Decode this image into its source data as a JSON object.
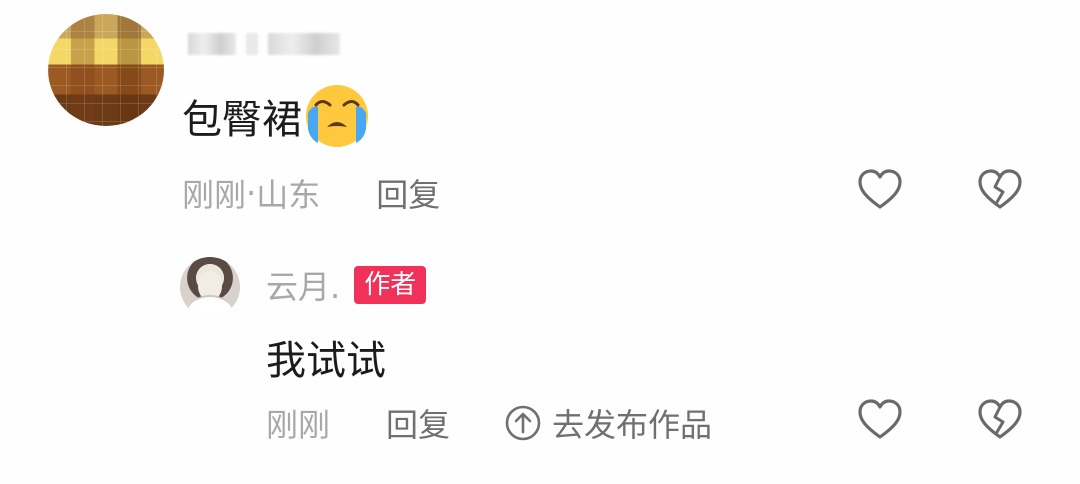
{
  "comment": {
    "text": "包臀裙",
    "emoji": "loudly-crying-face-emoji",
    "time": "刚刚",
    "separator": " · ",
    "location": "山东",
    "reply_label": "回复",
    "like_icon": "heart-icon",
    "dislike_icon": "broken-heart-icon"
  },
  "reply": {
    "author": "云月.",
    "badge": "作者",
    "text": "我试试",
    "time": "刚刚",
    "reply_label": "回复",
    "publish_label": "去发布作品",
    "publish_icon": "arrow-up-circle-icon",
    "like_icon": "heart-icon",
    "dislike_icon": "broken-heart-icon"
  },
  "colors": {
    "badge_bg": "#f0325a",
    "meta_text": "#a8a8a8",
    "action_text": "#707070",
    "body_text": "#1c1c1c",
    "icon_stroke": "#6a6a6a"
  }
}
